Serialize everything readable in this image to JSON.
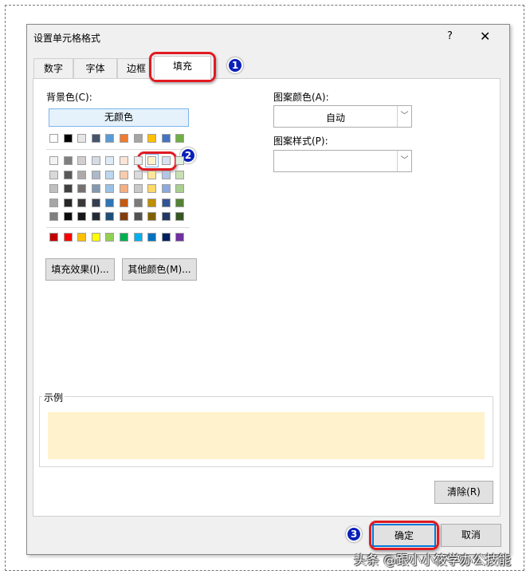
{
  "dialog": {
    "title": "设置单元格格式",
    "help": "?",
    "close": "✕"
  },
  "tabs": [
    {
      "label": "数字"
    },
    {
      "label": "字体"
    },
    {
      "label": "边框"
    },
    {
      "label": "填充"
    }
  ],
  "fill": {
    "bg_label": "背景色(C):",
    "no_color": "无颜色",
    "theme_row": [
      "#FFFFFF",
      "#000000",
      "#E7E6E6",
      "#44546A",
      "#5B9BD5",
      "#ED7D31",
      "#A5A5A5",
      "#FFC000",
      "#4472C4",
      "#70AD47"
    ],
    "tint_rows": [
      [
        "#F2F2F2",
        "#7F7F7F",
        "#D0CECE",
        "#D6DCE4",
        "#DDEBF7",
        "#FCE4D6",
        "#EDEDED",
        "#FFF2CC",
        "#D9E1F2",
        "#E2EFDA"
      ],
      [
        "#D9D9D9",
        "#595959",
        "#AEAAAA",
        "#ACB9CA",
        "#BDD7EE",
        "#F8CBAD",
        "#DBDBDB",
        "#FFE699",
        "#B4C6E7",
        "#C6E0B4"
      ],
      [
        "#BFBFBF",
        "#404040",
        "#757171",
        "#8497B0",
        "#9BC2E6",
        "#F4B084",
        "#C9C9C9",
        "#FFD966",
        "#8EA9DB",
        "#A9D08E"
      ],
      [
        "#A6A6A6",
        "#262626",
        "#3A3838",
        "#333F4F",
        "#2F75B5",
        "#C65911",
        "#7B7B7B",
        "#BF8F00",
        "#305496",
        "#548235"
      ],
      [
        "#808080",
        "#0D0D0D",
        "#161616",
        "#222B35",
        "#1F4E78",
        "#833C0C",
        "#525252",
        "#806000",
        "#203764",
        "#375623"
      ]
    ],
    "standard_row": [
      "#C00000",
      "#FF0000",
      "#FFC000",
      "#FFFF00",
      "#92D050",
      "#00B050",
      "#00B0F0",
      "#0070C0",
      "#002060",
      "#7030A0"
    ],
    "selected_color": "#FFF2CC",
    "fill_effects": "填充效果(I)...",
    "more_colors": "其他颜色(M)...",
    "pattern_color_label": "图案颜色(A):",
    "pattern_color_value": "自动",
    "pattern_style_label": "图案样式(P):",
    "pattern_style_value": "",
    "sample_label": "示例",
    "clear": "清除(R)"
  },
  "footer": {
    "ok": "确定",
    "cancel": "取消"
  },
  "annotations": [
    "1",
    "2",
    "3"
  ],
  "watermark": "头条 @跟小小筱学办公技能"
}
